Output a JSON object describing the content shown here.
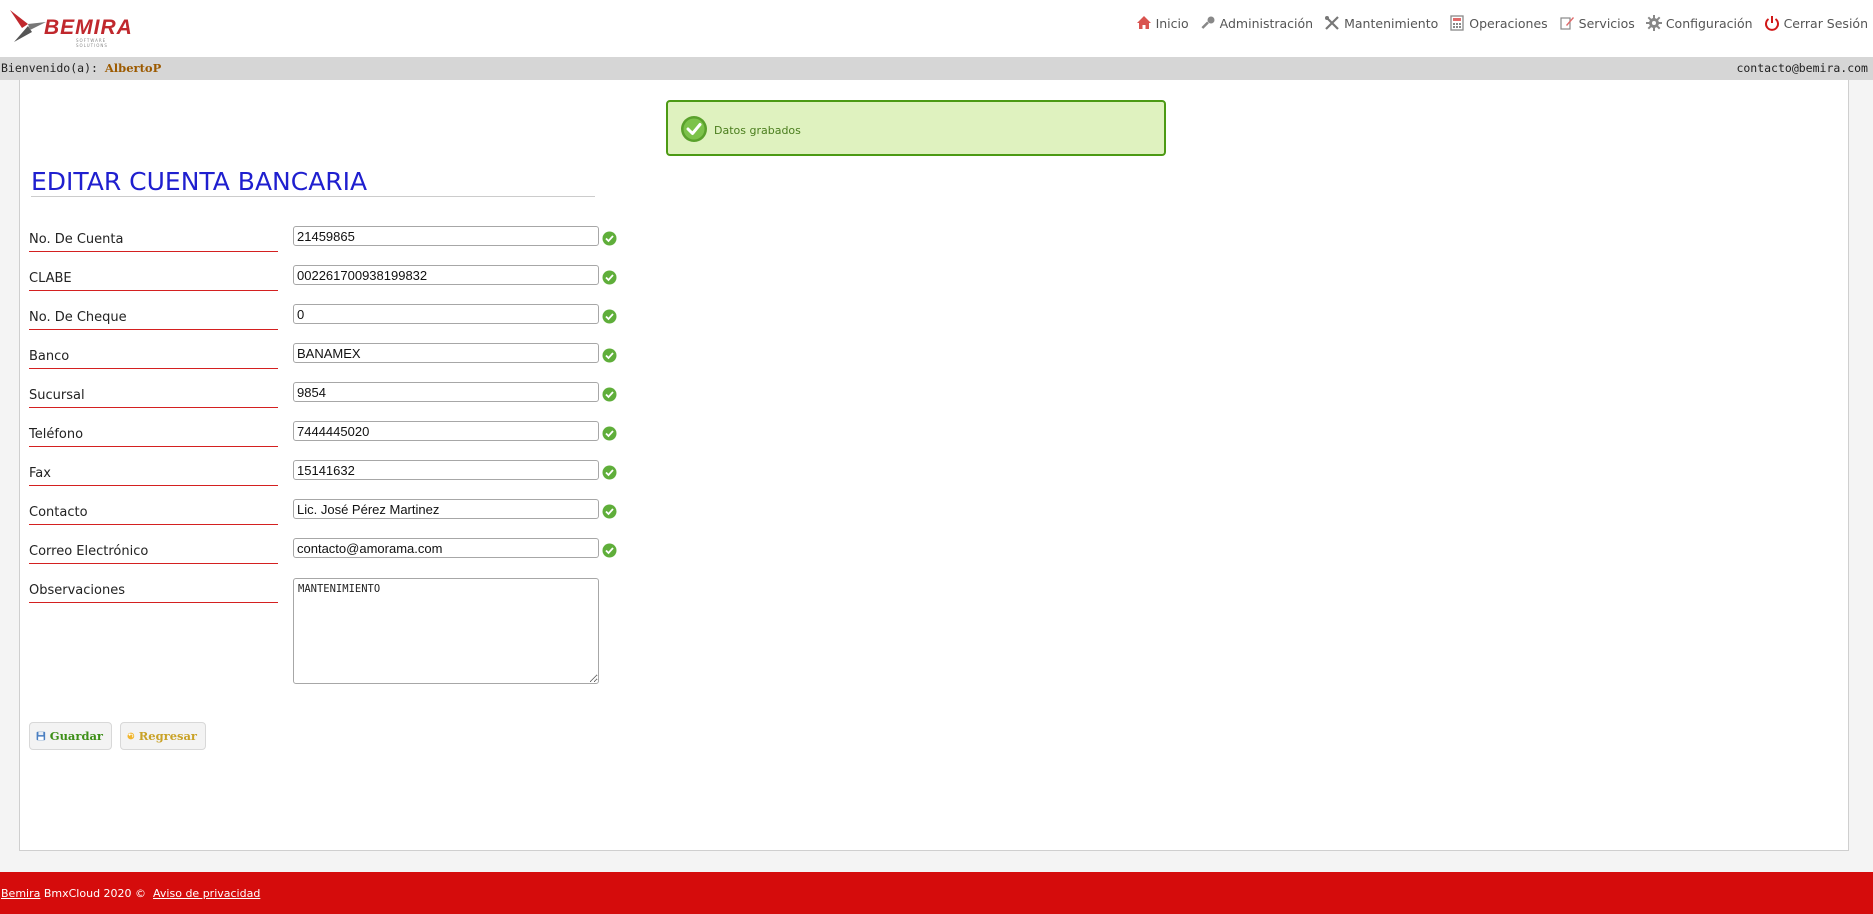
{
  "brand": {
    "logo_text": "BEMIRA",
    "logo_tagline": "SOFTWARE SOLUTIONS",
    "accent": "#d50c0c"
  },
  "nav": {
    "items": [
      {
        "label": "Inicio",
        "icon": "home-icon"
      },
      {
        "label": "Administración",
        "icon": "key-icon"
      },
      {
        "label": "Mantenimiento",
        "icon": "tools-icon"
      },
      {
        "label": "Operaciones",
        "icon": "calculator-icon"
      },
      {
        "label": "Servicios",
        "icon": "edit-icon"
      },
      {
        "label": "Configuración",
        "icon": "gear-icon"
      },
      {
        "label": "Cerrar Sesión",
        "icon": "power-icon"
      }
    ]
  },
  "userbar": {
    "welcome_label": "Bienvenido(a):",
    "username": "AlbertoP",
    "email": "contacto@bemira.com"
  },
  "notice": {
    "text": "Datos grabados",
    "icon": "check-icon"
  },
  "page": {
    "title": "EDITAR CUENTA BANCARIA"
  },
  "form": {
    "fields": [
      {
        "label": "No. De Cuenta",
        "value": "21459865"
      },
      {
        "label": "CLABE",
        "value": "002261700938199832"
      },
      {
        "label": "No. De Cheque",
        "value": "0"
      },
      {
        "label": "Banco",
        "value": "BANAMEX"
      },
      {
        "label": "Sucursal",
        "value": "9854"
      },
      {
        "label": "Teléfono",
        "value": "7444445020"
      },
      {
        "label": "Fax",
        "value": "15141632"
      },
      {
        "label": "Contacto",
        "value": "Lic. José Pérez Martinez"
      },
      {
        "label": "Correo Electrónico",
        "value": "contacto@amorama.com"
      }
    ],
    "observaciones": {
      "label": "Observaciones",
      "value": "MANTENIMIENTO"
    }
  },
  "buttons": {
    "save_label": "Guardar",
    "back_label": "Regresar"
  },
  "footer": {
    "brand_link": "Bemira",
    "text": "BmxCloud 2020 ©",
    "privacy_link": "Aviso de privacidad"
  }
}
